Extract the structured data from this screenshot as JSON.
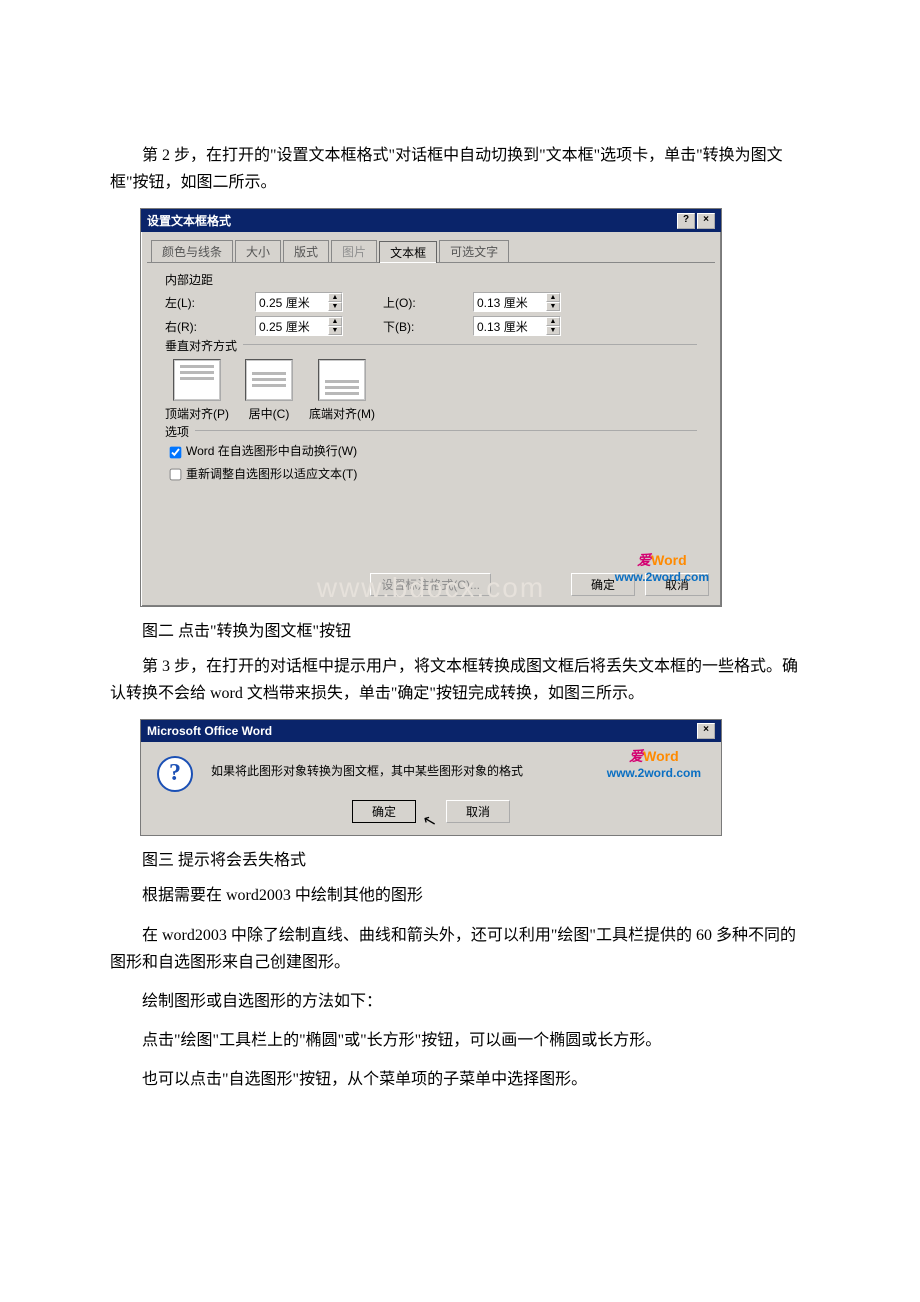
{
  "doc": {
    "p1": "第 2 步，在打开的\"设置文本框格式\"对话框中自动切换到\"文本框\"选项卡，单击\"转换为图文框\"按钮，如图二所示。",
    "cap1": "图二 点击\"转换为图文框\"按钮",
    "p2": "第 3 步，在打开的对话框中提示用户，将文本框转换成图文框后将丢失文本框的一些格式。确认转换不会给 word 文档带来损失，单击\"确定\"按钮完成转换，如图三所示。",
    "cap2": "图三 提示将会丢失格式",
    "p3": "根据需要在 word2003 中绘制其他的图形",
    "p4": "在 word2003 中除了绘制直线、曲线和箭头外，还可以利用\"绘图\"工具栏提供的 60 多种不同的图形和自选图形来自己创建图形。",
    "p5": "绘制图形或自选图形的方法如下：",
    "p6": "点击\"绘图\"工具栏上的\"椭圆\"或\"长方形\"按钮，可以画一个椭圆或长方形。",
    "p7": "也可以点击\"自选图形\"按钮，从个菜单项的子菜单中选择图形。"
  },
  "dlg1": {
    "title": "设置文本框格式",
    "tabs": {
      "colors": "颜色与线条",
      "size": "大小",
      "layout": "版式",
      "picture": "图片",
      "textbox": "文本框",
      "alttext": "可选文字"
    },
    "grp_margin": "内部边距",
    "left_l": "左(L):",
    "left_v": "0.25 厘米",
    "right_l": "右(R):",
    "right_v": "0.25 厘米",
    "top_l": "上(O):",
    "top_v": "0.13 厘米",
    "bot_l": "下(B):",
    "bot_v": "0.13 厘米",
    "grp_valign": "垂直对齐方式",
    "va_top": "顶端对齐(P)",
    "va_mid": "居中(C)",
    "va_bot": "底端对齐(M)",
    "grp_opts": "选项",
    "opt1": "Word 在自选图形中自动换行(W)",
    "opt2": "重新调整自选图形以适应文本(T)",
    "btn_callout": "设置标注格式(C)...",
    "btn_ok": "确定",
    "btn_cancel": "取消",
    "wm_brand": "Word",
    "wm_ai": "爱",
    "wm_url": "www.2word.com",
    "bg_wm": "www.bdocx.com"
  },
  "dlg2": {
    "title": "Microsoft Office Word",
    "msg": "如果将此图形对象转换为图文框，其中某些图形对象的格式",
    "btn_ok": "确定",
    "btn_cancel": "取消",
    "wm_brand": "Word",
    "wm_ai": "爱",
    "wm_url": "www.2word.com"
  }
}
